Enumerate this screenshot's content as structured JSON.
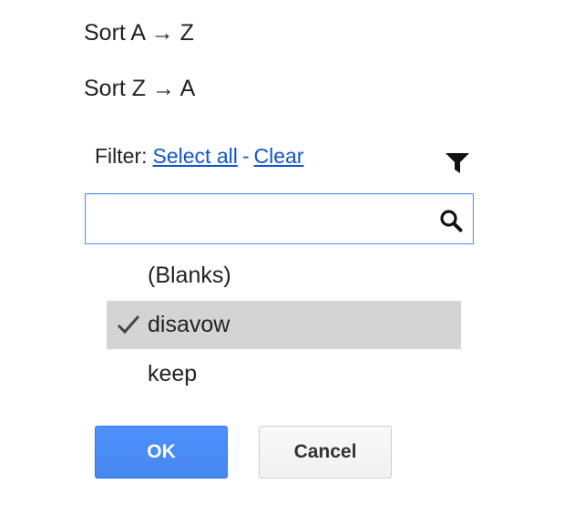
{
  "sort": {
    "ascending_label": "Sort A → Z",
    "descending_label": "Sort Z → A"
  },
  "filter": {
    "label": "Filter:",
    "select_all_label": "Select all",
    "separator": "-",
    "clear_label": "Clear",
    "icon": "filter-funnel-icon"
  },
  "search": {
    "value": "",
    "placeholder": "",
    "icon": "search-icon"
  },
  "values": [
    {
      "label": "(Blanks)",
      "checked": false
    },
    {
      "label": "disavow",
      "checked": true
    },
    {
      "label": "keep",
      "checked": false
    }
  ],
  "buttons": {
    "ok_label": "OK",
    "cancel_label": "Cancel"
  },
  "colors": {
    "accent": "#4d90fe",
    "link": "#1155cc",
    "selected_row": "#d4d4d4"
  }
}
